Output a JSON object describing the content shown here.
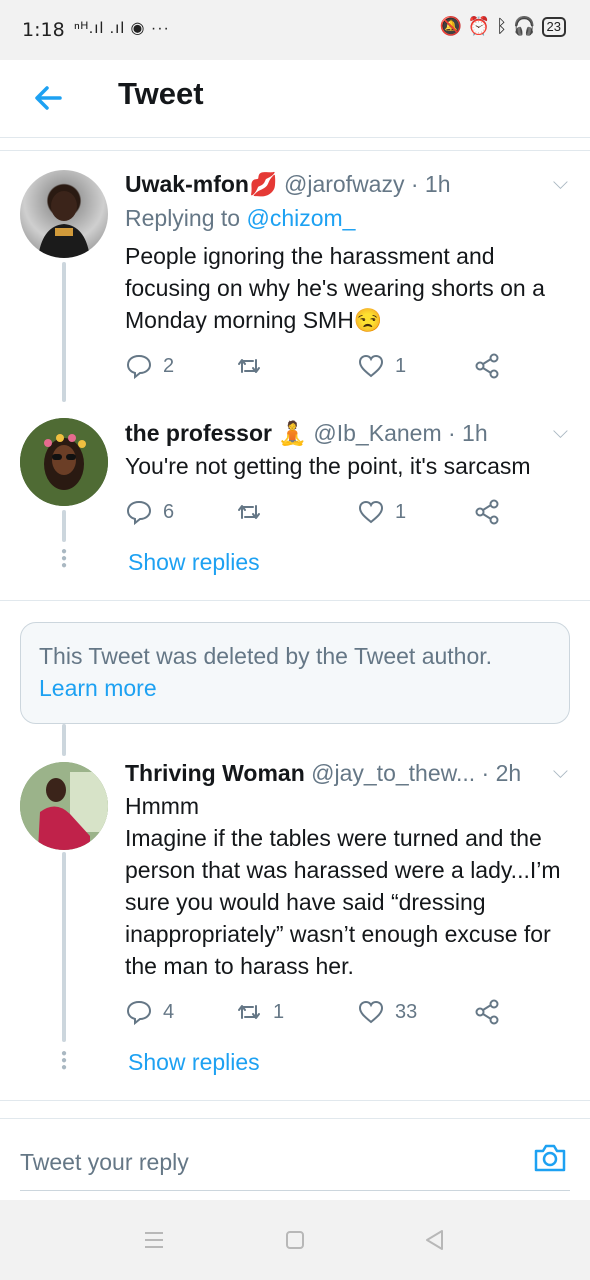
{
  "status_bar": {
    "time": "1:18",
    "left_icons": "ⁿᴴ.ıl .ıl ◉ ···",
    "battery": "23"
  },
  "header": {
    "title": "Tweet"
  },
  "tweets": [
    {
      "name": "Uwak-mfon💋",
      "handle": "@jarofwazy · 1h",
      "reply_label": "Replying to ",
      "reply_to": "@chizom_",
      "text": "People ignoring the harassment and focusing on why he's wearing shorts on a Monday morning SMH😒",
      "replies": "2",
      "retweets": "",
      "likes": "1"
    },
    {
      "name": "the professor 🧘",
      "handle": "@Ib_Kanem · 1h",
      "text": "You're not getting the point, it's sarcasm",
      "replies": "6",
      "retweets": "",
      "likes": "1",
      "show_replies": "Show replies"
    },
    {
      "name": "Thriving Woman",
      "handle": "@jay_to_thew...  · 2h",
      "text_line1": "Hmmm",
      "text": "Imagine if the tables were turned and the person that was harassed were a lady...I’m sure you would have said “dressing inappropriately” wasn’t enough excuse for the man to harass her.",
      "replies": "4",
      "retweets": "1",
      "likes": "33",
      "show_replies": "Show replies"
    }
  ],
  "deleted_notice": {
    "text": "This Tweet was deleted by the Tweet author.",
    "link": "Learn more"
  },
  "reply_bar": {
    "placeholder": "Tweet your reply"
  },
  "colors": {
    "accent": "#1da1f2",
    "muted": "#657786",
    "border": "#e1e8ed"
  }
}
